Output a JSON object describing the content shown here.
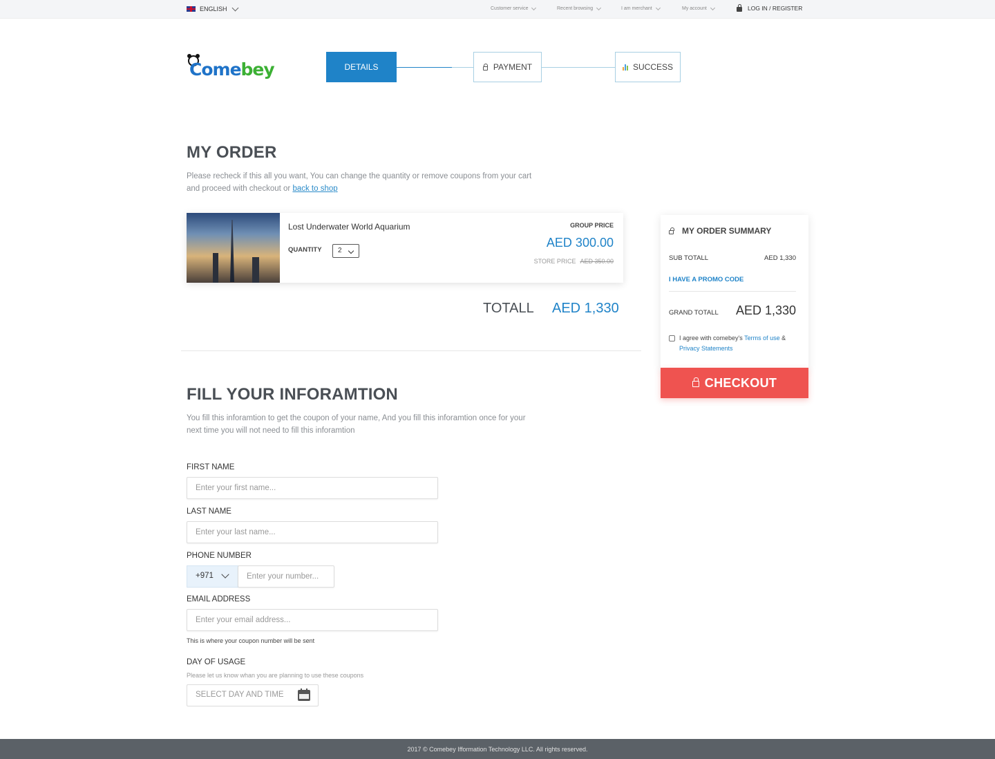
{
  "topbar": {
    "language": "ENGLISH",
    "nav": [
      "Customer service",
      "Recent browsing",
      "I am merchant",
      "My account"
    ],
    "login": "LOG IN / REGISTER"
  },
  "brand": {
    "logo_a": "Come",
    "logo_b": "bey"
  },
  "steps": {
    "details": "DETAILS",
    "payment": "PAYMENT",
    "success": "SUCCESS"
  },
  "order": {
    "title": "MY ORDER",
    "lead": "Please recheck if this all you want, You can change the quantity or remove coupons from your cart and proceed with checkout or ",
    "back_link": "back to shop",
    "item": {
      "name": "Lost Underwater World Aquarium",
      "quantity_label": "QUANTITY",
      "quantity": "2",
      "group_price_label": "GROUP PRICE",
      "group_price": "AED 300.00",
      "store_price_label": "STORE PRICE",
      "store_price": "AED 350.00"
    },
    "total_label": "TOTALL",
    "total_value": "AED 1,330"
  },
  "summary": {
    "title": "MY ORDER SUMMARY",
    "subtotal_label": "SUB TOTALL",
    "subtotal": "AED 1,330",
    "promo": "I HAVE A PROMO CODE",
    "grand_label": "GRAND TOTALL",
    "grand": "AED 1,330",
    "agree_text": "I agree with comebey's ",
    "terms": "Terms of use",
    "amp": " & ",
    "privacy": "Privacy Statements",
    "checkout": "CHECKOUT"
  },
  "form": {
    "title": "FILL YOUR INFORAMTION",
    "lead": "You fill this inforamtion to get the coupon of your name, And you fill this inforamtion once for your next time you will not need to fill this inforamtion",
    "first_label": "FIRST NAME",
    "first_placeholder": "Enter your first name...",
    "last_label": "LAST NAME",
    "last_placeholder": "Enter your last name...",
    "phone_label": "PHONE NUMBER",
    "country_code": "+971",
    "phone_placeholder": "Enter your number...",
    "email_label": "EMAIL ADDRESS",
    "email_placeholder": "Enter your email address...",
    "email_hint": "This is where your coupon number will be sent",
    "day_label": "DAY OF USAGE",
    "day_hint": "Please let us know whan you are planning to use these coupons",
    "day_button": "SELECT DAY AND TIME"
  },
  "footer": {
    "text": "2017 © Comebey Ifformation Technology LLC. All rights reserved."
  }
}
